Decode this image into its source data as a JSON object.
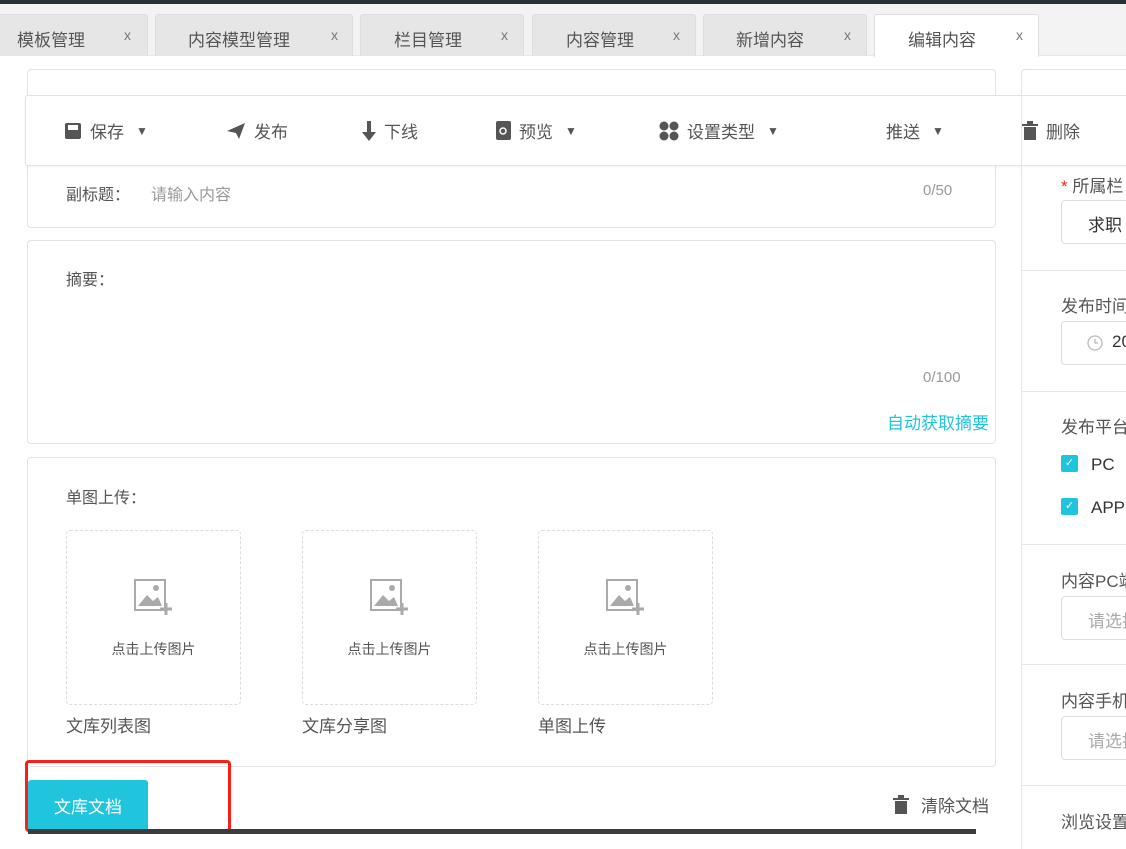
{
  "tabs": [
    {
      "label": "模板管理",
      "close": "x"
    },
    {
      "label": "内容模型管理",
      "close": "x"
    },
    {
      "label": "栏目管理",
      "close": "x"
    },
    {
      "label": "内容管理",
      "close": "x"
    },
    {
      "label": "新增内容",
      "close": "x"
    },
    {
      "label": "编辑内容",
      "close": "x"
    }
  ],
  "toolbar": {
    "save": "保存",
    "publish": "发布",
    "offline": "下线",
    "preview": "预览",
    "set_type": "设置类型",
    "push": "推送",
    "delete": "删除"
  },
  "form": {
    "subtitle_label": "副标题：",
    "subtitle_placeholder": "请输入内容",
    "subtitle_count": "0/50",
    "summary_label": "摘要：",
    "summary_count": "0/100",
    "auto_summary": "自动获取摘要",
    "upload_label": "单图上传：",
    "upload_hint": "点击上传图片",
    "uploads": [
      {
        "caption": "文库列表图"
      },
      {
        "caption": "文库分享图"
      },
      {
        "caption": "单图上传"
      }
    ],
    "doc_button": "文库文档",
    "clear_doc": "清除文档"
  },
  "right": {
    "required_mark": "*",
    "column_label": "所属栏",
    "column_value": "求职",
    "publish_time_label": "发布时间",
    "publish_time_value": "20",
    "platform_label": "发布平台",
    "platforms": [
      "PC",
      "APP"
    ],
    "pc_template_label": "内容PC端",
    "pc_placeholder": "请选择",
    "mobile_template_label": "内容手机",
    "mobile_placeholder": "请选择",
    "browse_label": "浏览设置"
  },
  "colors": {
    "accent": "#21c4dd",
    "highlight": "#f5221b"
  }
}
